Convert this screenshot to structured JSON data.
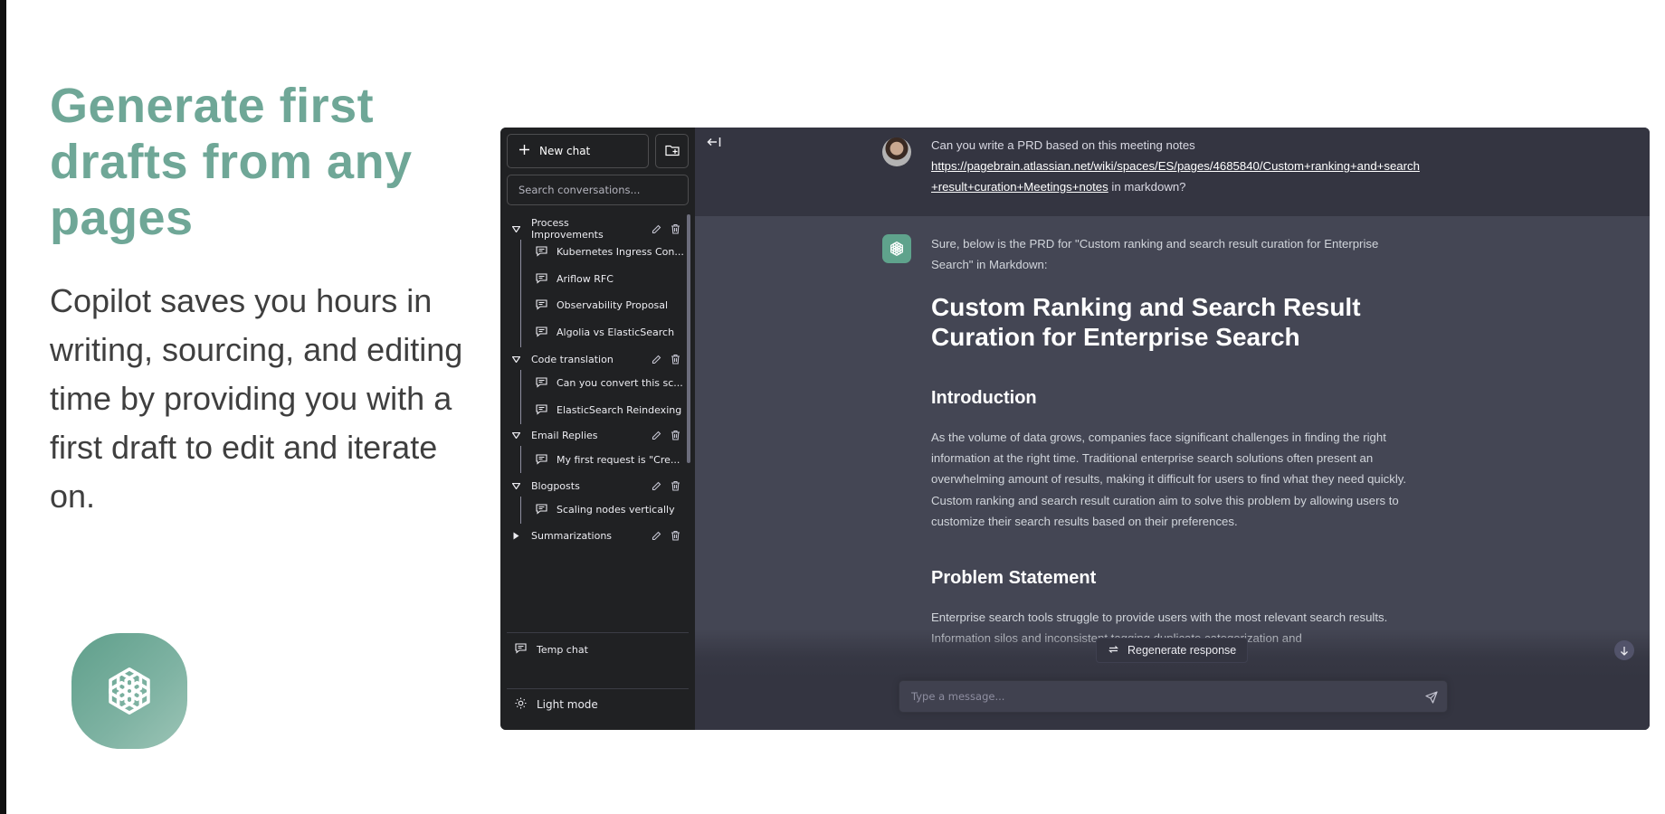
{
  "hero": {
    "title": "Generate first drafts from any pages",
    "description": "Copilot saves you hours in writing, sourcing, and editing time by providing you with a first draft to edit and iterate on."
  },
  "colors": {
    "accent": "#6fa797",
    "sidebar_bg": "#202123",
    "main_bg": "#444654",
    "user_row_bg": "#343541"
  },
  "sidebar": {
    "new_chat_label": "New chat",
    "search_placeholder": "Search conversations...",
    "folders": [
      {
        "name": "Process Improvements",
        "expanded": true,
        "items": [
          "Kubernetes Ingress Con...",
          "Ariflow RFC",
          "Observability Proposal",
          "Algolia vs ElasticSearch"
        ]
      },
      {
        "name": "Code translation",
        "expanded": true,
        "items": [
          "Can you convert this sc...",
          "ElasticSearch Reindexing"
        ]
      },
      {
        "name": "Email Replies",
        "expanded": true,
        "items": [
          "My first request is \"Cre..."
        ]
      },
      {
        "name": "Blogposts",
        "expanded": true,
        "items": [
          "Scaling nodes vertically"
        ]
      },
      {
        "name": "Summarizations",
        "expanded": false,
        "items": []
      }
    ],
    "temp_chat_label": "Temp chat",
    "light_mode_label": "Light mode"
  },
  "chat": {
    "user_message_prefix": "Can you write a PRD based on this meeting notes",
    "user_message_link": "https://pagebrain.atlassian.net/wiki/spaces/ES/pages/4685840/Custom+ranking+and+search+result+curation+Meetings+notes",
    "user_message_suffix": " in markdown?",
    "assistant_intro": "Sure, below is the PRD for \"Custom ranking and search result curation for Enterprise Search\" in Markdown:",
    "doc_title": "Custom Ranking and Search Result Curation for Enterprise Search",
    "section1_heading": "Introduction",
    "section1_body": "As the volume of data grows, companies face significant challenges in finding the right information at the right time. Traditional enterprise search solutions often present an overwhelming amount of results, making it difficult for users to find what they need quickly. Custom ranking and search result curation aim to solve this problem by allowing users to customize their search results based on their preferences.",
    "section2_heading": "Problem Statement",
    "section2_body": "Enterprise search tools struggle to provide users with the most relevant search results. Information silos and inconsistent tagging duplicate categorization and",
    "regenerate_label": "Regenerate response",
    "input_placeholder": "Type a message..."
  },
  "icons": {
    "new_chat": "plus-icon",
    "new_folder": "folder-plus-icon",
    "folder_caret": "caret-icon",
    "edit": "pencil-icon",
    "delete": "trash-icon",
    "conversation": "chat-bubble-icon",
    "light_mode": "sun-icon",
    "collapse_sidebar": "collapse-left-icon",
    "regenerate": "refresh-icon",
    "scroll_down": "arrow-down-icon",
    "send": "send-icon",
    "openai_logo": "openai-logo-icon"
  }
}
